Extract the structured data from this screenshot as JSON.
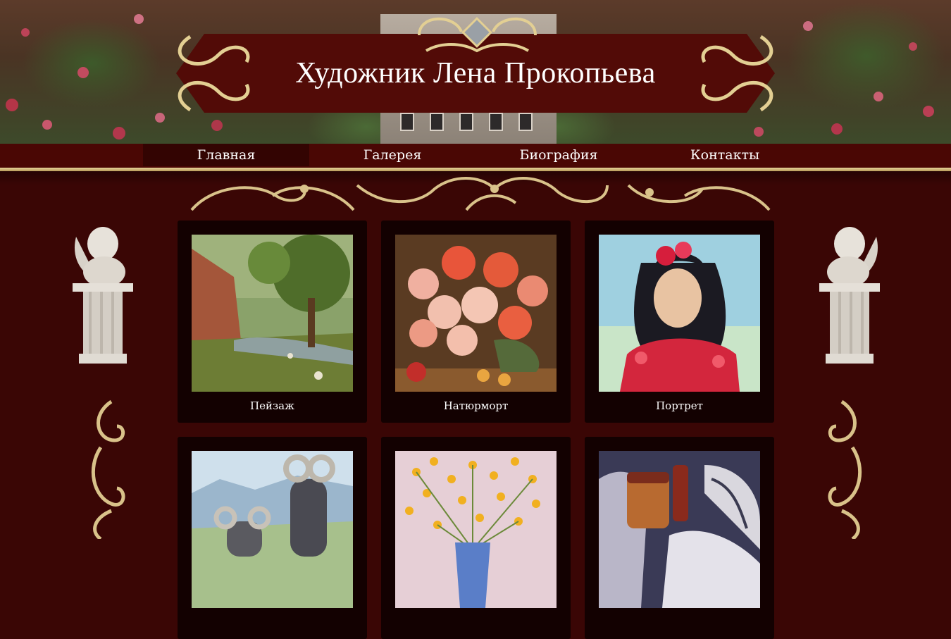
{
  "site": {
    "title": "Художник Лена Прокопьева"
  },
  "nav": {
    "items": [
      {
        "label": "Главная",
        "active": true
      },
      {
        "label": "Галерея",
        "active": false
      },
      {
        "label": "Биография",
        "active": false
      },
      {
        "label": "Контакты",
        "active": false
      }
    ]
  },
  "gallery": {
    "cards": [
      {
        "caption": "Пейзаж",
        "image": "landscape-painting"
      },
      {
        "caption": "Натюрморт",
        "image": "rose-still-life-painting"
      },
      {
        "caption": "Портрет",
        "image": "girl-portrait-painting"
      },
      {
        "caption": "",
        "image": "rams-painting"
      },
      {
        "caption": "",
        "image": "yellow-flowers-painting"
      },
      {
        "caption": "",
        "image": "still-life-bird-painting"
      }
    ]
  },
  "colors": {
    "page_bg": "#3a0605",
    "nav_bg": "#4a0704",
    "nav_active_bg": "#330402",
    "gold": "#d9c28a",
    "card_bg": "#130101",
    "text": "#ffffff"
  }
}
